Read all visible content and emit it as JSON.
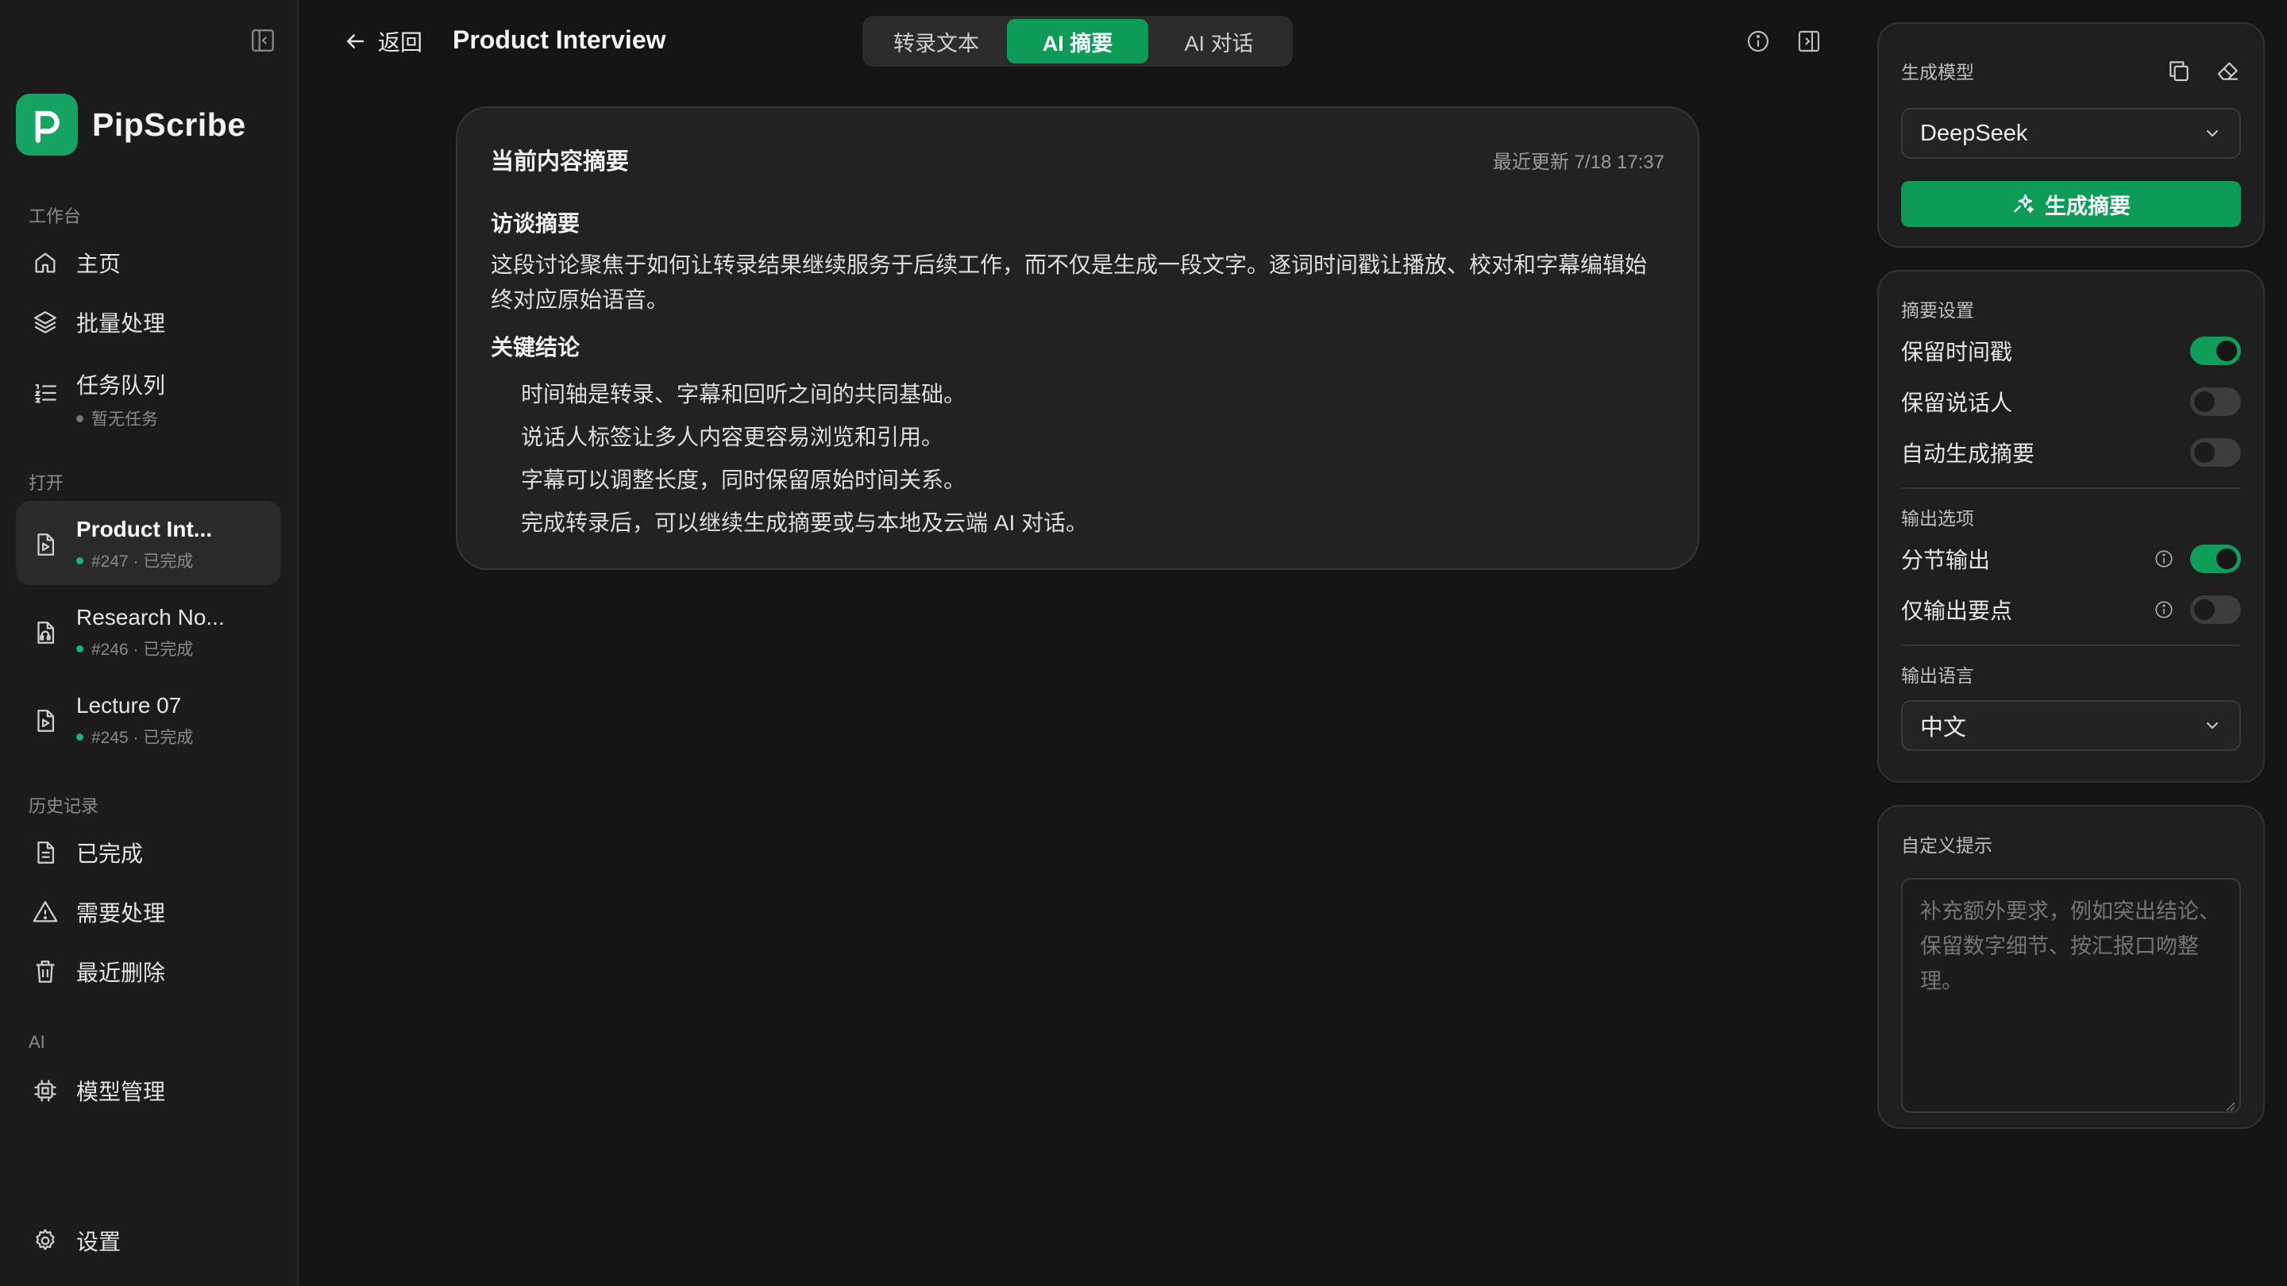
{
  "app": {
    "name": "PipScribe"
  },
  "sidebar": {
    "workspace_label": "工作台",
    "workspace_items": [
      {
        "label": "主页",
        "icon": "home-icon"
      },
      {
        "label": "批量处理",
        "icon": "layers-icon"
      },
      {
        "label": "任务队列",
        "icon": "list-icon",
        "sub": "暂无任务"
      }
    ],
    "open_label": "打开",
    "open_files": [
      {
        "label": "Product Int...",
        "meta": "#247 · 已完成",
        "icon": "file-video-icon",
        "active": true
      },
      {
        "label": "Research No...",
        "meta": "#246 · 已完成",
        "icon": "file-audio-icon"
      },
      {
        "label": "Lecture 07",
        "meta": "#245 · 已完成",
        "icon": "file-video-icon"
      }
    ],
    "history_label": "历史记录",
    "history_items": [
      {
        "label": "已完成",
        "icon": "document-icon"
      },
      {
        "label": "需要处理",
        "icon": "warning-icon"
      },
      {
        "label": "最近删除",
        "icon": "trash-icon"
      }
    ],
    "ai_label": "AI",
    "ai_items": [
      {
        "label": "模型管理",
        "icon": "chip-icon"
      }
    ],
    "settings_label": "设置"
  },
  "header": {
    "back_label": "返回",
    "title": "Product Interview",
    "tabs": [
      {
        "label": "转录文本",
        "active": false
      },
      {
        "label": "AI 摘要",
        "active": true
      },
      {
        "label": "AI 对话",
        "active": false
      }
    ]
  },
  "summary": {
    "title": "当前内容摘要",
    "updated": "最近更新 7/18 17:37",
    "overview_heading": "访谈摘要",
    "overview_text": "这段讨论聚焦于如何让转录结果继续服务于后续工作，而不仅是生成一段文字。逐词时间戳让播放、校对和字幕编辑始终对应原始语音。",
    "conclusions_heading": "关键结论",
    "conclusions": [
      "时间轴是转录、字幕和回听之间的共同基础。",
      "说话人标签让多人内容更容易浏览和引用。",
      "字幕可以调整长度，同时保留原始时间关系。",
      "完成转录后，可以继续生成摘要或与本地及云端 AI 对话。"
    ]
  },
  "model_panel": {
    "label": "生成模型",
    "selected_model": "DeepSeek",
    "generate_label": "生成摘要"
  },
  "settings_panel": {
    "summary_label": "摘要设置",
    "summary_options": [
      {
        "label": "保留时间戳",
        "on": true
      },
      {
        "label": "保留说话人",
        "on": false
      },
      {
        "label": "自动生成摘要",
        "on": false
      }
    ],
    "output_label": "输出选项",
    "output_options": [
      {
        "label": "分节输出",
        "on": true,
        "info": true
      },
      {
        "label": "仅输出要点",
        "on": false,
        "info": true
      }
    ],
    "language_label": "输出语言",
    "language": "中文"
  },
  "prompt_panel": {
    "label": "自定义提示",
    "placeholder": "补充额外要求，例如突出结论、保留数字细节、按汇报口吻整理。"
  },
  "colors": {
    "accent": "#0e9b57",
    "background": "#141414",
    "sidebar": "#1b1b1b"
  }
}
